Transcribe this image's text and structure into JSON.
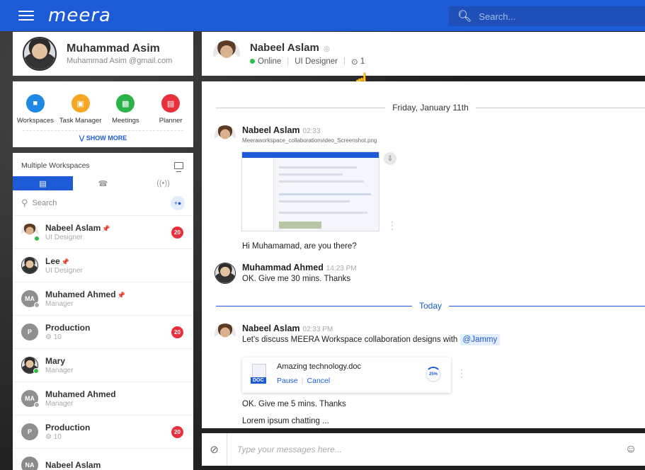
{
  "app": {
    "logo": "meera",
    "search_placeholder": "Search..."
  },
  "profile": {
    "name": "Muhammad Asim",
    "email": "Muhammad Asim @gmail.com"
  },
  "apps": [
    {
      "label": "Workspaces",
      "icon": "workspace-icon",
      "color": "#1e88e5"
    },
    {
      "label": "Task Manager",
      "icon": "task-manager-icon",
      "color": "#f5a623"
    },
    {
      "label": "Meetings",
      "icon": "meetings-icon",
      "color": "#2bb34a"
    },
    {
      "label": "Planner",
      "icon": "planner-icon",
      "color": "#e8303c"
    }
  ],
  "show_more": "SHOW MORE",
  "list": {
    "title": "Multiple Workspaces",
    "search_placeholder": "Search",
    "contacts": [
      {
        "name": "Nabeel Aslam",
        "pin": "📌",
        "role": "UI Designer",
        "badge": "20"
      },
      {
        "name": "Lee",
        "pin": "📌",
        "role": "UI Designer",
        "badge": ""
      },
      {
        "name": "Muhamed Ahmed",
        "pin": "📌",
        "role": "Manager",
        "initials": "MA",
        "badge": ""
      },
      {
        "name": "Production",
        "role": "10",
        "initials": "P",
        "badge": "20"
      },
      {
        "name": "Mary",
        "role": "Manager",
        "badge": ""
      },
      {
        "name": "Muhamed Ahmed",
        "role": "Manager",
        "initials": "MA",
        "badge": ""
      },
      {
        "name": "Production",
        "role": "10",
        "initials": "P",
        "badge": "20"
      },
      {
        "name": "Nabeel Aslam",
        "role": "",
        "initials": "NA",
        "badge": ""
      }
    ]
  },
  "chat": {
    "header": {
      "name": "Nabeel Aslam",
      "status": "Online",
      "role": "UI Designer",
      "attachments": "1"
    },
    "date_divider": "Friday, January 11th",
    "today_divider": "Today",
    "messages": [
      {
        "name": "Nabeel Aslam",
        "time": "02:33",
        "file": "Meeraworkspace_collaborationvideo_Screenshot.png"
      },
      {
        "text": "Hi Muhamamad, are you there?"
      },
      {
        "name": "Muhammad Ahmed",
        "time": "14:23 PM",
        "text": "OK. Give me 30 mins. Thanks"
      },
      {
        "name": "Nabeel Aslam",
        "time": "02:33 PM",
        "text": "Let's discuss MEERA Workspace collaboration designs with",
        "mention": "@Jammy"
      },
      {
        "text": "OK. Give me 5 mins. Thanks"
      },
      {
        "text": "Lorem ipsum chatting ..."
      }
    ],
    "document": {
      "name": "Amazing technology.doc",
      "type": "DOC",
      "pause": "Pause",
      "cancel": "Cancel",
      "progress": "25%"
    },
    "composer_placeholder": "Type your messages here..."
  }
}
